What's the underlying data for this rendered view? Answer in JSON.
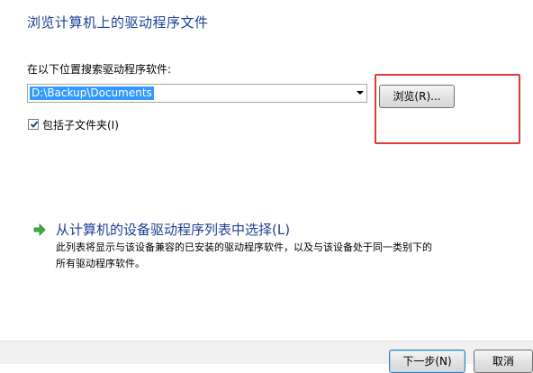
{
  "header": {
    "title": "浏览计算机上的驱动程序文件"
  },
  "search": {
    "label": "在以下位置搜索驱动程序软件:",
    "path_value": "D:\\Backup\\Documents",
    "browse_label": "浏览(R)...",
    "include_subfolders_label": "包括子文件夹(I)",
    "include_subfolders_checked": true
  },
  "pick_option": {
    "title": "从计算机的设备驱动程序列表中选择(L)",
    "description_line1": "此列表将显示与该设备兼容的已安装的驱动程序软件，以及与该设备处于同一类别下的",
    "description_line2": "所有驱动程序软件。",
    "icon": "green-arrow-icon"
  },
  "footer": {
    "next_label": "下一步(N)",
    "cancel_label": "取消"
  },
  "colors": {
    "title_blue": "#1e3f96",
    "selection_blue": "#3399ff",
    "highlight_red": "#e23a3a"
  }
}
